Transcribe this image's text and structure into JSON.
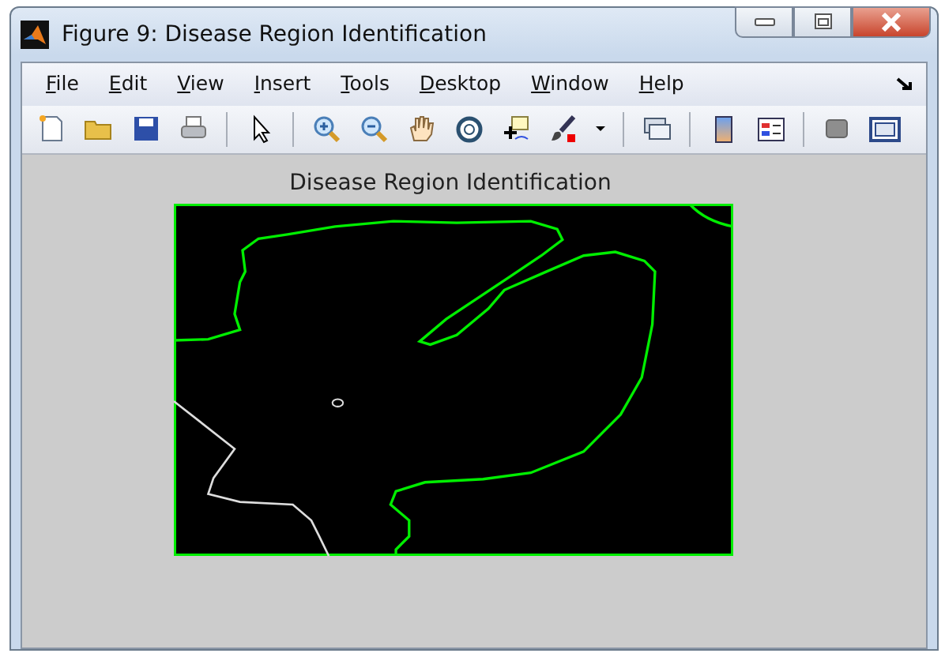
{
  "window": {
    "title": "Figure 9: Disease Region Identification"
  },
  "menu": [
    "File",
    "Edit",
    "View",
    "Insert",
    "Tools",
    "Desktop",
    "Window",
    "Help"
  ],
  "figure": {
    "title": "Disease Region Identification"
  }
}
